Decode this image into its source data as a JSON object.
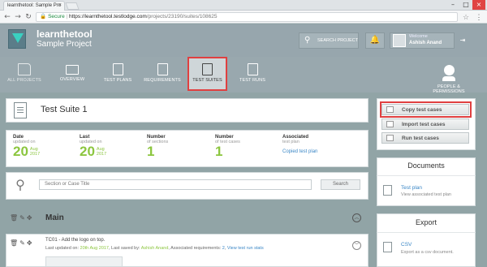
{
  "browser": {
    "tab_title": "learnthetool: Sample Pro",
    "secure_label": "Secure",
    "url_host": "https://learnthetool.testlodge.com",
    "url_path": "/projects/23190/suites/108625"
  },
  "header": {
    "app_name": "learnthetool",
    "project_name": "Sample Project",
    "search_label": "SEARCH PROJECT",
    "welcome_label": "Welcome",
    "user_name": "Ashish Anand"
  },
  "nav": {
    "items": [
      {
        "label": "ALL PROJECTS"
      },
      {
        "label": "OVERVIEW"
      },
      {
        "label": "TEST PLANS"
      },
      {
        "label": "REQUIREMENTS"
      },
      {
        "label": "TEST SUITES"
      },
      {
        "label": "TEST RUNS"
      },
      {
        "label": "PEOPLE &"
      },
      {
        "label": "PERMISSIONS"
      }
    ],
    "active": "TEST SUITES"
  },
  "suite": {
    "title": "Test Suite 1",
    "stats": {
      "date_label": "Date",
      "date_sub": "updated on",
      "date_day": "20",
      "date_month": "Aug",
      "date_year": "2017",
      "last_label": "Last",
      "last_sub": "updated on",
      "last_day": "20",
      "last_month": "Aug",
      "last_year": "2017",
      "sections_label": "Number",
      "sections_sub": "of sections",
      "sections_value": "1",
      "cases_label": "Number",
      "cases_sub": "of test cases",
      "cases_value": "1",
      "assoc_label": "Associated",
      "assoc_sub": "test plan",
      "assoc_link": "Copied test plan"
    },
    "search_placeholder": "Section or Case Title",
    "search_button": "Search",
    "section_title": "Main",
    "test_case": {
      "title": "TC01 - Add the logo on top.",
      "updated_prefix": "Last updated on:",
      "updated_date": "20th Aug 2017",
      "saved_prefix": ", Last saved by:",
      "saved_by": "Ashish Anand",
      "req_prefix": ", Associated requirements:",
      "req_count": "2",
      "run_stats_link": "View test run stats"
    }
  },
  "sidebar": {
    "actions": {
      "copy": "Copy test cases",
      "import": "Import test cases",
      "run": "Run test cases"
    },
    "documents": {
      "heading": "Documents",
      "link": "Test plan",
      "desc": "View associated test plan"
    },
    "export": {
      "heading": "Export",
      "link": "CSV",
      "desc": "Export as a csv document."
    }
  }
}
